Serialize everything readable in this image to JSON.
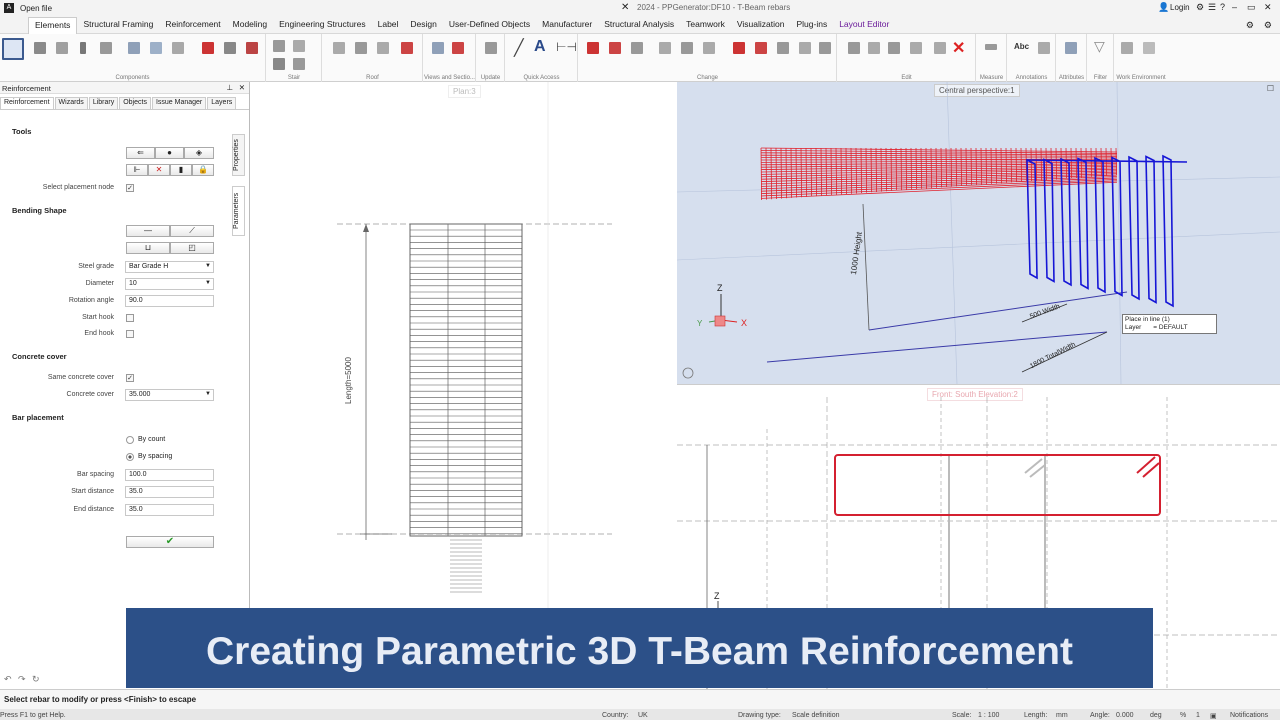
{
  "titlebar": {
    "open_file": "Open file",
    "title": "2024 - PPGenerator:DF10 - T-Beam rebars",
    "login": "Login"
  },
  "ribbon_tabs": [
    "Elements",
    "Structural Framing",
    "Reinforcement",
    "Modeling",
    "Engineering Structures",
    "Label",
    "Design",
    "User-Defined Objects",
    "Manufacturer",
    "Structural Analysis",
    "Teamwork",
    "Visualization",
    "Plug-ins",
    "Layout Editor"
  ],
  "ribbon_groups": [
    "Components",
    "Stair",
    "Roof",
    "Views and Sectio...",
    "Update",
    "Quick Access",
    "Change",
    "Edit",
    "Measure",
    "Annotations",
    "Attributes",
    "Filter",
    "Work Environment"
  ],
  "left_panel": {
    "title": "Reinforcement",
    "tabs": [
      "Reinforcement",
      "Wizards",
      "Library",
      "Objects",
      "Issue Manager",
      "Layers"
    ],
    "vertical_tabs": [
      "Properties",
      "Parameters"
    ],
    "tools_heading": "Tools",
    "select_node_label": "Select placement node",
    "bending_heading": "Bending Shape",
    "steel_grade_label": "Steel grade",
    "steel_grade_value": "Bar Grade H",
    "diameter_label": "Diameter",
    "diameter_value": "10",
    "rotation_label": "Rotation angle",
    "rotation_value": "90.0",
    "start_hook_label": "Start hook",
    "end_hook_label": "End hook",
    "cover_heading": "Concrete cover",
    "same_cover_label": "Same concrete cover",
    "cover_label": "Concrete cover",
    "cover_value": "35.000",
    "placement_heading": "Bar placement",
    "by_count": "By count",
    "by_spacing": "By spacing",
    "bar_spacing_label": "Bar spacing",
    "bar_spacing_value": "100.0",
    "start_distance_label": "Start distance",
    "start_distance_value": "35.0",
    "end_distance_label": "End distance",
    "end_distance_value": "35.0"
  },
  "views": {
    "plan_label": "Plan:3",
    "plan_length": "Length=5000",
    "persp_label": "Central perspective:1",
    "height_dim": "1000 Height",
    "width_dim": "500 Width",
    "total_width_dim": "1800 TotalWidth",
    "tooltip_line1": "Place in line  (1)",
    "tooltip_line2_key": "Layer",
    "tooltip_line2_val": "= DEFAULT",
    "front_label": "Front: South Elevation:2"
  },
  "banner": "Creating Parametric 3D T-Beam Reinforcement",
  "command_line": "Select rebar to modify or press <Finish> to escape",
  "status": {
    "help": "Press F1 to get Help.",
    "country_label": "Country:",
    "country": "UK",
    "drawing_type_label": "Drawing type:",
    "drawing_type": "Scale definition",
    "scale_label": "Scale:",
    "scale": "1 : 100",
    "length_label": "Length:",
    "length_unit": "mm",
    "angle_label": "Angle:",
    "angle": "0.000",
    "angle_unit": "deg",
    "percent": "%",
    "percent_val": "1",
    "notifications": "Notifications"
  },
  "colors": {
    "banner": "#2c5088",
    "rebar_red": "#e0202c",
    "rebar_blue": "#1616d6",
    "viewport_bg": "#d6dfee"
  }
}
